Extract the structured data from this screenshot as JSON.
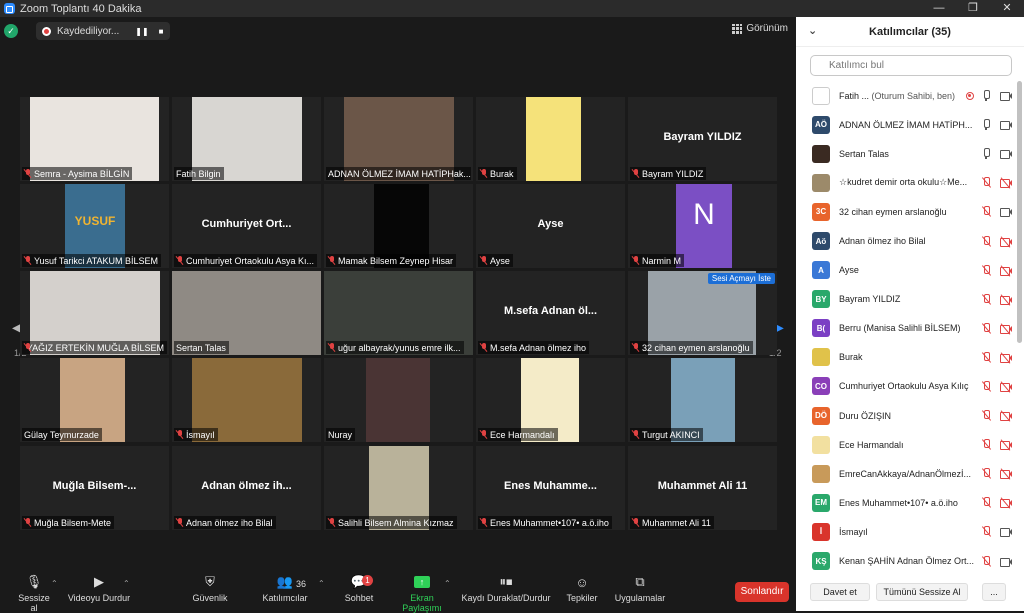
{
  "window": {
    "title": "Zoom Toplantı 40 Dakika",
    "controls": [
      "—",
      "❐",
      "✕"
    ]
  },
  "recording": {
    "label": "Kaydediliyor..."
  },
  "view": {
    "label": "Görünüm"
  },
  "pagination": {
    "left": "1/2",
    "right": "1/2"
  },
  "tiles": [
    {
      "label": "Semra - Aysima BİLGİN",
      "big": "",
      "muted": true
    },
    {
      "label": "Fatih Bilgin",
      "big": "",
      "muted": false
    },
    {
      "label": "ADNAN ÖLMEZ İMAM HATİPHak...",
      "big": "",
      "muted": false
    },
    {
      "label": "Burak",
      "big": "",
      "muted": true
    },
    {
      "label": "Bayram YILDIZ",
      "big": "Bayram YILDIZ",
      "muted": true
    },
    {
      "label": "Yusuf Tarikci ATAKUM BİLSEM",
      "big": "",
      "muted": true
    },
    {
      "label": "Cumhuriyet Ortaokulu Asya Kı...",
      "big": "Cumhuriyet  Ort...",
      "muted": true
    },
    {
      "label": "Mamak Bilsem Zeynep Hisar",
      "big": "",
      "muted": true
    },
    {
      "label": "Ayse",
      "big": "Ayse",
      "muted": true
    },
    {
      "label": "Narmin M",
      "big": "",
      "muted": true
    },
    {
      "label": "YAĞIZ ERTEKİN MUĞLA BİLSEM",
      "big": "",
      "muted": true
    },
    {
      "label": "Sertan Talas",
      "big": "",
      "muted": false
    },
    {
      "label": "uğur albayrak/yunus emre ilk...",
      "big": "",
      "muted": true
    },
    {
      "label": "M.sefa Adnan ölmez iho",
      "big": "M.sefa  Adnan  öl...",
      "muted": true
    },
    {
      "label": "32 cihan eymen arslanoğlu",
      "big": "",
      "muted": true
    },
    {
      "label": "Gülay Teymurzade",
      "big": "",
      "muted": false
    },
    {
      "label": "İsmayıl",
      "big": "",
      "muted": true
    },
    {
      "label": "Nuray",
      "big": "",
      "muted": false
    },
    {
      "label": "Ece Harmandalı",
      "big": "",
      "muted": true
    },
    {
      "label": "Turgut AKINCI",
      "big": "",
      "muted": true
    },
    {
      "label": "Muğla Bilsem-Mete",
      "big": "Muğla  Bilsem-...",
      "muted": true
    },
    {
      "label": "Adnan ölmez iho Bilal",
      "big": "Adnan  ölmez  ih...",
      "muted": true
    },
    {
      "label": "Salihli Bilsem Almina Kızmaz",
      "big": "",
      "muted": true
    },
    {
      "label": "Enes Muhammet•107• a.ö.iho",
      "big": "Enes  Muhamme...",
      "muted": true
    },
    {
      "label": "Muhammet Ali 11",
      "big": "Muhammet Ali 11",
      "muted": true
    }
  ],
  "tile_extras": {
    "yusuf_text": "YUSUF",
    "narmin_initial": "N",
    "unmute_hint": "Sesi Açmayı İste"
  },
  "toolbar": {
    "mute": "Sessize al",
    "video": "Videoyu Durdur",
    "security": "Güvenlik",
    "participants": "Katılımcılar",
    "participants_count": "36",
    "chat": "Sohbet",
    "chat_badge": "1",
    "share": "Ekran Paylaşımı",
    "record": "Kaydı Duraklat/Durdur",
    "reactions": "Tepkiler",
    "apps": "Uygulamalar",
    "end": "Sonlandır"
  },
  "panel": {
    "title": "Katılımcılar (35)",
    "search_placeholder": "Katılımcı bul",
    "participants": [
      {
        "initials": "",
        "color": "#ffffff",
        "name": "Fatih ...",
        "suffix": "(Oturum Sahibi, ben)",
        "mic": "on",
        "video": "on",
        "rec": true
      },
      {
        "initials": "AÖ",
        "color": "#2e4a6b",
        "name": "ADNAN ÖLMEZ İMAM HATİPH...",
        "suffix": "",
        "mic": "on",
        "video": "on",
        "rec": false
      },
      {
        "initials": "",
        "color": "#3a2a22",
        "name": "Sertan Talas",
        "suffix": "",
        "mic": "on",
        "video": "on",
        "rec": false
      },
      {
        "initials": "",
        "color": "#9c8a6a",
        "name": "☆kudret demir orta okulu☆Me...",
        "suffix": "",
        "mic": "off",
        "video": "off",
        "rec": false
      },
      {
        "initials": "3C",
        "color": "#e8642c",
        "name": "32 cihan eymen arslanoğlu",
        "suffix": "",
        "mic": "off",
        "video": "on",
        "rec": false
      },
      {
        "initials": "Aö",
        "color": "#2e4a6b",
        "name": "Adnan ölmez iho Bilal",
        "suffix": "",
        "mic": "off",
        "video": "off",
        "rec": false
      },
      {
        "initials": "A",
        "color": "#3a78d6",
        "name": "Ayse",
        "suffix": "",
        "mic": "off",
        "video": "off",
        "rec": false
      },
      {
        "initials": "BY",
        "color": "#2aa86b",
        "name": "Bayram YILDIZ",
        "suffix": "",
        "mic": "off",
        "video": "off",
        "rec": false
      },
      {
        "initials": "B(",
        "color": "#7b3fc4",
        "name": "Berru (Manisa Salihli BİLSEM)",
        "suffix": "",
        "mic": "off",
        "video": "off",
        "rec": false
      },
      {
        "initials": "",
        "color": "#e0c24a",
        "name": "Burak",
        "suffix": "",
        "mic": "off",
        "video": "off",
        "rec": false
      },
      {
        "initials": "CO",
        "color": "#8a3fb8",
        "name": "Cumhuriyet Ortaokulu Asya Kılıç",
        "suffix": "",
        "mic": "off",
        "video": "off",
        "rec": false
      },
      {
        "initials": "DÖ",
        "color": "#e8642c",
        "name": "Duru ÖZIŞIN",
        "suffix": "",
        "mic": "off",
        "video": "off",
        "rec": false
      },
      {
        "initials": "",
        "color": "#f2e0a0",
        "name": "Ece Harmandalı",
        "suffix": "",
        "mic": "off",
        "video": "off",
        "rec": false
      },
      {
        "initials": "",
        "color": "#c89a5a",
        "name": "EmreCanAkkaya/AdnanÖlmezİ...",
        "suffix": "",
        "mic": "off",
        "video": "off",
        "rec": false
      },
      {
        "initials": "EM",
        "color": "#2aa86b",
        "name": "Enes Muhammet•107• a.ö.iho",
        "suffix": "",
        "mic": "off",
        "video": "off",
        "rec": false
      },
      {
        "initials": "İ",
        "color": "#d9342b",
        "name": "İsmayıl",
        "suffix": "",
        "mic": "off",
        "video": "on",
        "rec": false
      },
      {
        "initials": "KŞ",
        "color": "#2aa86b",
        "name": "Kenan ŞAHİN Adnan Ölmez Ort...",
        "suffix": "",
        "mic": "off",
        "video": "on",
        "rec": false
      }
    ],
    "invite": "Davet et",
    "mute_all": "Tümünü Sessize Al",
    "more": "..."
  }
}
